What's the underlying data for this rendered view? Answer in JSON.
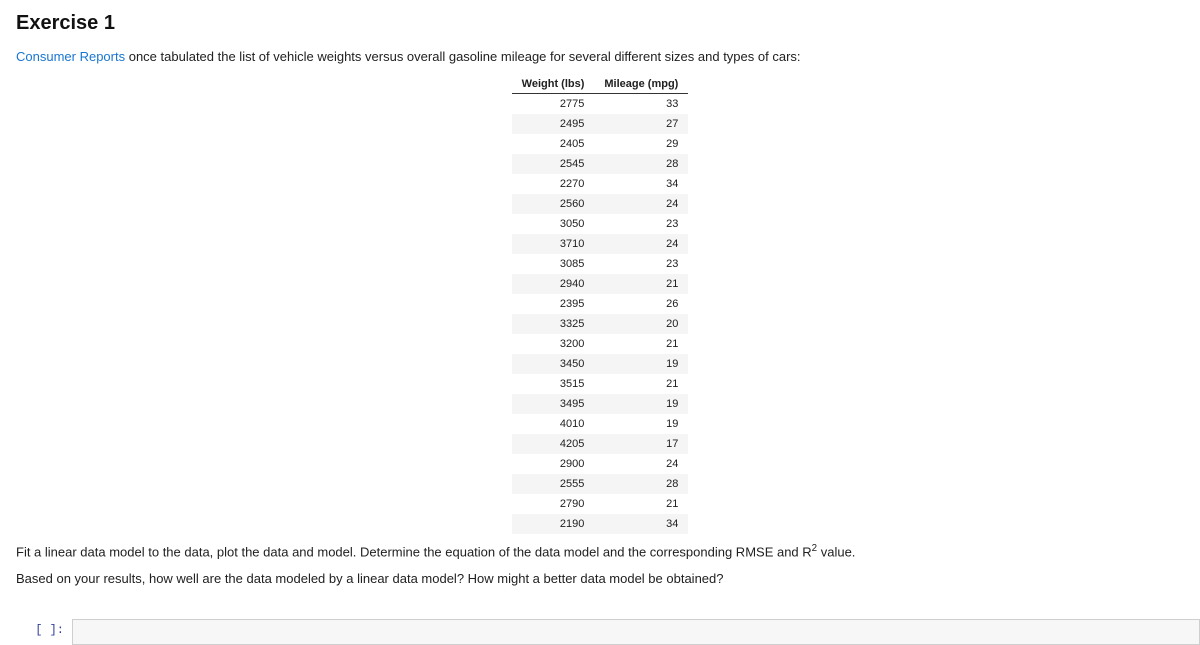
{
  "heading": "Exercise 1",
  "intro": {
    "link_text": "Consumer Reports",
    "link_href": "#",
    "rest": " once tabulated the list of vehicle weights versus overall gasoline mileage for several different sizes and types of cars:"
  },
  "table": {
    "headers": [
      "Weight (lbs)",
      "Mileage (mpg)"
    ],
    "rows": [
      [
        "2775",
        "33"
      ],
      [
        "2495",
        "27"
      ],
      [
        "2405",
        "29"
      ],
      [
        "2545",
        "28"
      ],
      [
        "2270",
        "34"
      ],
      [
        "2560",
        "24"
      ],
      [
        "3050",
        "23"
      ],
      [
        "3710",
        "24"
      ],
      [
        "3085",
        "23"
      ],
      [
        "2940",
        "21"
      ],
      [
        "2395",
        "26"
      ],
      [
        "3325",
        "20"
      ],
      [
        "3200",
        "21"
      ],
      [
        "3450",
        "19"
      ],
      [
        "3515",
        "21"
      ],
      [
        "3495",
        "19"
      ],
      [
        "4010",
        "19"
      ],
      [
        "4205",
        "17"
      ],
      [
        "2900",
        "24"
      ],
      [
        "2555",
        "28"
      ],
      [
        "2790",
        "21"
      ],
      [
        "2190",
        "34"
      ]
    ]
  },
  "para2_pre": "Fit a linear data model to the data, plot the data and model. Determine the equation of the data model and the corresponding RMSE and R",
  "para2_sup": "2",
  "para2_post": " value.",
  "para3": "Based on your results, how well are the data modeled by a linear data model? How might a better data model be obtained?",
  "prompt_label": "[ ]:"
}
